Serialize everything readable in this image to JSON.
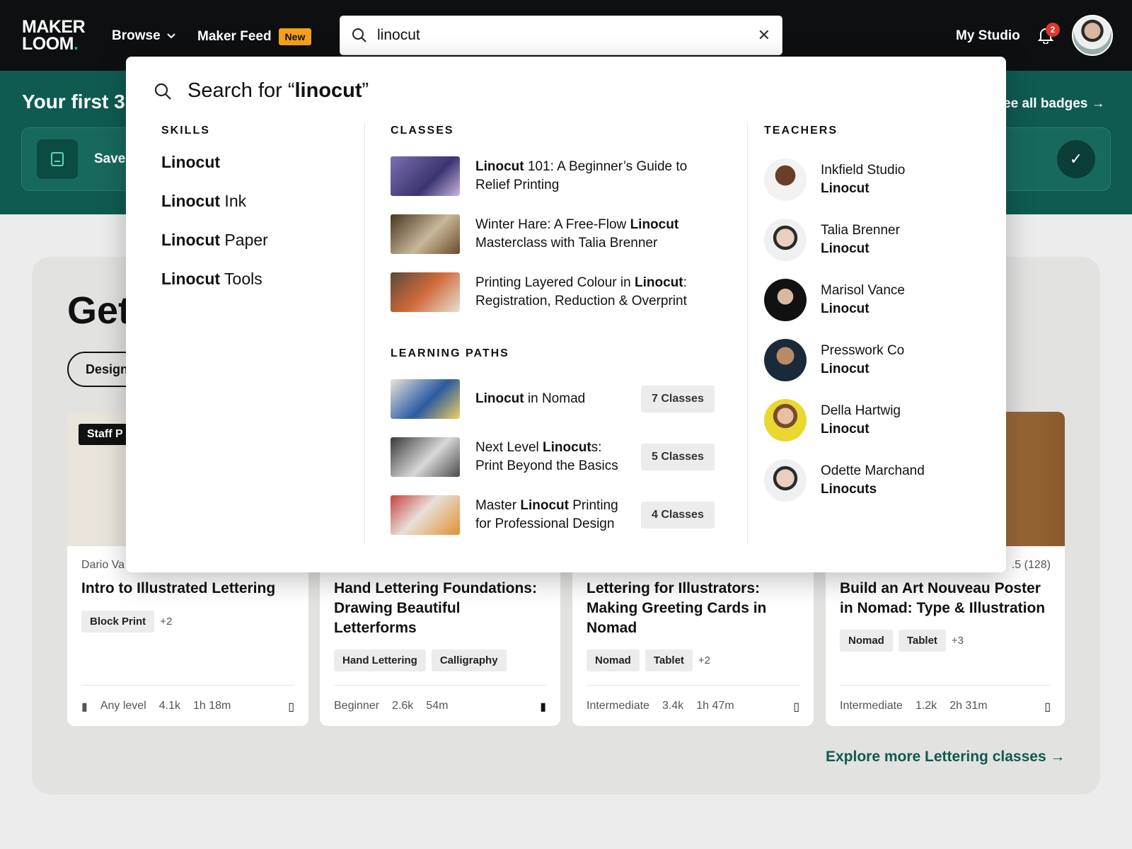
{
  "header": {
    "logo_line1": "MAKER",
    "logo_line2": "LOOM",
    "logo_dot": ".",
    "browse": "Browse",
    "feed": "Maker Feed",
    "feed_badge": "New",
    "search_value": "linocut",
    "my_studio": "My Studio",
    "notifications": "2"
  },
  "banner": {
    "title": "Your first 3 b",
    "link": "ee all badges",
    "save_label": "Save"
  },
  "section": {
    "heading": "Get",
    "pill": "Design",
    "explore": "Explore more Lettering classes"
  },
  "cards": [
    {
      "badge": "Staff P",
      "author": "Dario Va",
      "title": "Intro to Illustrated Lettering",
      "tags": [
        "Block Print"
      ],
      "more": "+2",
      "level": "Any level",
      "students": "4.1k",
      "duration": "1h 18m"
    },
    {
      "author": "",
      "title": "Hand Lettering Foundations: Drawing Beautiful Letterforms",
      "tags": [
        "Hand Lettering",
        "Calligraphy"
      ],
      "more": "",
      "level": "Beginner",
      "students": "2.6k",
      "duration": "54m"
    },
    {
      "author": "",
      "title": "Lettering for Illustrators: Making Greeting Cards in Nomad",
      "tags": [
        "Nomad",
        "Tablet"
      ],
      "more": "+2",
      "level": "Intermediate",
      "students": "3.4k",
      "duration": "1h 47m"
    },
    {
      "author": ".5 (128)",
      "title": "Build an Art Nouveau Poster in Nomad: Type & Illustration",
      "tags": [
        "Nomad",
        "Tablet"
      ],
      "more": "+3",
      "level": "Intermediate",
      "students": "1.2k",
      "duration": "2h 31m"
    }
  ],
  "dropdown": {
    "search_prefix": "Search for “",
    "search_term": "linocut",
    "search_suffix": "”",
    "skills_heading": "SKILLS",
    "classes_heading": "CLASSES",
    "paths_heading": "LEARNING PATHS",
    "teachers_heading": "TEACHERS",
    "skills": [
      {
        "bold": "Linocut",
        "rest": ""
      },
      {
        "bold": "Linocut",
        "rest": " Ink"
      },
      {
        "bold": "Linocut",
        "rest": " Paper"
      },
      {
        "bold": "Linocut",
        "rest": " Tools"
      }
    ],
    "classes": [
      {
        "pre": "",
        "bold": "Linocut",
        "post": " 101: A Beginner’s Guide to Relief Printing"
      },
      {
        "pre": "Winter Hare: A Free-Flow ",
        "bold": "Linocut",
        "post": " Masterclass with Talia Brenner"
      },
      {
        "pre": "Printing Layered Colour in ",
        "bold": "Linocut",
        "post": ": Registration, Reduction & Overprint"
      }
    ],
    "paths": [
      {
        "pre": "",
        "bold": "Linocut",
        "post": " in Nomad",
        "count": "7 Classes"
      },
      {
        "pre": "Next Level ",
        "bold": "Linocut",
        "post": "s: Print Beyond the Basics",
        "count": "5 Classes"
      },
      {
        "pre": "Master ",
        "bold": "Linocut",
        "post": " Printing for Professional Design",
        "count": "4 Classes"
      }
    ],
    "teachers": [
      {
        "name": "Inkfield Studio",
        "skill": "Linocut"
      },
      {
        "name": "Talia Brenner",
        "skill": "Linocut"
      },
      {
        "name": "Marisol Vance",
        "skill": "Linocut"
      },
      {
        "name": "Presswork Co",
        "skill": "Linocut"
      },
      {
        "name": "Della Hartwig",
        "skill": "Linocut"
      },
      {
        "name": "Odette Marchand",
        "skill": "Linocuts"
      }
    ]
  },
  "colors": {
    "brand": "#0f5b50",
    "accent": "#f6a01a",
    "topbar": "#0d0f10"
  }
}
